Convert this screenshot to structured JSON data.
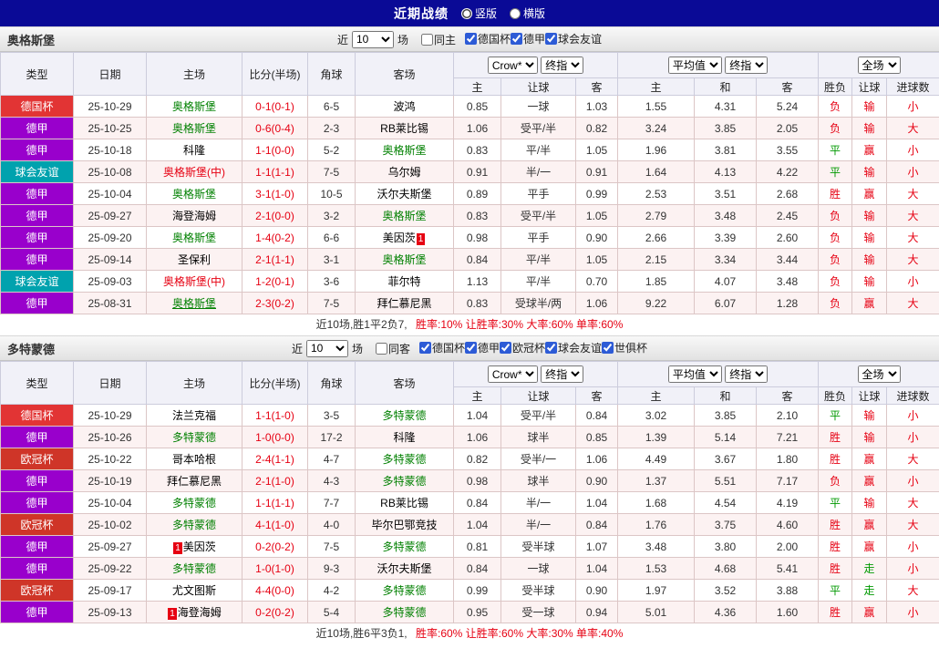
{
  "topbar": {
    "title": "近期战绩",
    "layout_options": [
      {
        "label": "竖版",
        "checked": true
      },
      {
        "label": "横版",
        "checked": false
      }
    ]
  },
  "labels": {
    "recent_prefix": "近",
    "recent_suffix": "场"
  },
  "table_header": {
    "cols": [
      "类型",
      "日期",
      "主场",
      "比分(半场)",
      "角球",
      "客场"
    ],
    "bookmaker": "Crow*",
    "final_label": "终指",
    "avg_label": "平均值",
    "scope_label": "全场",
    "sub": [
      "主",
      "让球",
      "客",
      "主",
      "和",
      "客",
      "胜负",
      "让球",
      "进球数"
    ]
  },
  "type_colors": {
    "德国杯": "#e23434",
    "德甲": "#9900cc",
    "球会友谊": "#00a2ae",
    "欧冠杯": "#cf3528",
    "世俱杯": "#888888"
  },
  "result_colors": {
    "r": "#e60012",
    "g": "#009900"
  },
  "sections": [
    {
      "team": "奥格斯堡",
      "filter": {
        "recent": "10",
        "same_label": "同主",
        "same_checked": false,
        "competitions": [
          {
            "label": "德国杯",
            "checked": true
          },
          {
            "label": "德甲",
            "checked": true
          },
          {
            "label": "球会友谊",
            "checked": true
          }
        ]
      },
      "rows": [
        {
          "tp": "德国杯",
          "dt": "25-10-29",
          "h": {
            "n": "奥格斯堡",
            "c": "g"
          },
          "sc": "0-1(0-1)",
          "cn": "6-5",
          "a": {
            "n": "波鸿"
          },
          "o1": [
            "0.85",
            "一球",
            "1.03"
          ],
          "o2": [
            "1.55",
            "4.31",
            "5.24"
          ],
          "rs": [
            [
              "负",
              "r"
            ],
            [
              "输",
              "r"
            ],
            [
              "小",
              "r"
            ]
          ]
        },
        {
          "tp": "德甲",
          "dt": "25-10-25",
          "h": {
            "n": "奥格斯堡",
            "c": "g"
          },
          "sc": "0-6(0-4)",
          "cn": "2-3",
          "a": {
            "n": "RB莱比锡"
          },
          "o1": [
            "1.06",
            "受平/半",
            "0.82"
          ],
          "o2": [
            "3.24",
            "3.85",
            "2.05"
          ],
          "rs": [
            [
              "负",
              "r"
            ],
            [
              "输",
              "r"
            ],
            [
              "大",
              "r"
            ]
          ]
        },
        {
          "tp": "德甲",
          "dt": "25-10-18",
          "h": {
            "n": "科隆"
          },
          "sc": "1-1(0-0)",
          "cn": "5-2",
          "a": {
            "n": "奥格斯堡",
            "c": "g"
          },
          "o1": [
            "0.83",
            "平/半",
            "1.05"
          ],
          "o2": [
            "1.96",
            "3.81",
            "3.55"
          ],
          "rs": [
            [
              "平",
              "g"
            ],
            [
              "赢",
              "r"
            ],
            [
              "小",
              "r"
            ]
          ]
        },
        {
          "tp": "球会友谊",
          "dt": "25-10-08",
          "h": {
            "n": "奥格斯堡(中)",
            "c": "r"
          },
          "sc": "1-1(1-1)",
          "cn": "7-5",
          "a": {
            "n": "乌尔姆"
          },
          "o1": [
            "0.91",
            "半/一",
            "0.91"
          ],
          "o2": [
            "1.64",
            "4.13",
            "4.22"
          ],
          "rs": [
            [
              "平",
              "g"
            ],
            [
              "输",
              "r"
            ],
            [
              "小",
              "r"
            ]
          ]
        },
        {
          "tp": "德甲",
          "dt": "25-10-04",
          "h": {
            "n": "奥格斯堡",
            "c": "g"
          },
          "sc": "3-1(1-0)",
          "cn": "10-5",
          "a": {
            "n": "沃尔夫斯堡"
          },
          "o1": [
            "0.89",
            "平手",
            "0.99"
          ],
          "o2": [
            "2.53",
            "3.51",
            "2.68"
          ],
          "rs": [
            [
              "胜",
              "r"
            ],
            [
              "赢",
              "r"
            ],
            [
              "大",
              "r"
            ]
          ]
        },
        {
          "tp": "德甲",
          "dt": "25-09-27",
          "h": {
            "n": "海登海姆"
          },
          "sc": "2-1(0-0)",
          "cn": "3-2",
          "a": {
            "n": "奥格斯堡",
            "c": "g"
          },
          "o1": [
            "0.83",
            "受平/半",
            "1.05"
          ],
          "o2": [
            "2.79",
            "3.48",
            "2.45"
          ],
          "rs": [
            [
              "负",
              "r"
            ],
            [
              "输",
              "r"
            ],
            [
              "大",
              "r"
            ]
          ]
        },
        {
          "tp": "德甲",
          "dt": "25-09-20",
          "h": {
            "n": "奥格斯堡",
            "c": "g"
          },
          "sc": "1-4(0-2)",
          "cn": "6-6",
          "a": {
            "n": "美因茨",
            "b": "1",
            "bp": "r"
          },
          "o1": [
            "0.98",
            "平手",
            "0.90"
          ],
          "o2": [
            "2.66",
            "3.39",
            "2.60"
          ],
          "rs": [
            [
              "负",
              "r"
            ],
            [
              "输",
              "r"
            ],
            [
              "大",
              "r"
            ]
          ]
        },
        {
          "tp": "德甲",
          "dt": "25-09-14",
          "h": {
            "n": "圣保利"
          },
          "sc": "2-1(1-1)",
          "cn": "3-1",
          "a": {
            "n": "奥格斯堡",
            "c": "g"
          },
          "o1": [
            "0.84",
            "平/半",
            "1.05"
          ],
          "o2": [
            "2.15",
            "3.34",
            "3.44"
          ],
          "rs": [
            [
              "负",
              "r"
            ],
            [
              "输",
              "r"
            ],
            [
              "大",
              "r"
            ]
          ]
        },
        {
          "tp": "球会友谊",
          "dt": "25-09-03",
          "h": {
            "n": "奥格斯堡(中)",
            "c": "r"
          },
          "sc": "1-2(0-1)",
          "cn": "3-6",
          "a": {
            "n": "菲尔特"
          },
          "o1": [
            "1.13",
            "平/半",
            "0.70"
          ],
          "o2": [
            "1.85",
            "4.07",
            "3.48"
          ],
          "rs": [
            [
              "负",
              "r"
            ],
            [
              "输",
              "r"
            ],
            [
              "小",
              "r"
            ]
          ]
        },
        {
          "tp": "德甲",
          "dt": "25-08-31",
          "h": {
            "n": "奥格斯堡",
            "c": "g",
            "u": true
          },
          "sc": "2-3(0-2)",
          "cn": "7-5",
          "a": {
            "n": "拜仁慕尼黑"
          },
          "o1": [
            "0.83",
            "受球半/两",
            "1.06"
          ],
          "o2": [
            "9.22",
            "6.07",
            "1.28"
          ],
          "rs": [
            [
              "负",
              "r"
            ],
            [
              "赢",
              "r"
            ],
            [
              "大",
              "r"
            ]
          ]
        }
      ],
      "summary": {
        "prefix": "近10场,胜1平2负7,",
        "stats": "胜率:10% 让胜率:30% 大率:60% 单率:60%"
      }
    },
    {
      "team": "多特蒙德",
      "filter": {
        "recent": "10",
        "same_label": "同客",
        "same_checked": false,
        "competitions": [
          {
            "label": "德国杯",
            "checked": true
          },
          {
            "label": "德甲",
            "checked": true
          },
          {
            "label": "欧冠杯",
            "checked": true
          },
          {
            "label": "球会友谊",
            "checked": true
          },
          {
            "label": "世俱杯",
            "checked": true
          }
        ]
      },
      "rows": [
        {
          "tp": "德国杯",
          "dt": "25-10-29",
          "h": {
            "n": "法兰克福"
          },
          "sc": "1-1(1-0)",
          "cn": "3-5",
          "a": {
            "n": "多特蒙德",
            "c": "g"
          },
          "o1": [
            "1.04",
            "受平/半",
            "0.84"
          ],
          "o2": [
            "3.02",
            "3.85",
            "2.10"
          ],
          "rs": [
            [
              "平",
              "g"
            ],
            [
              "输",
              "r"
            ],
            [
              "小",
              "r"
            ]
          ]
        },
        {
          "tp": "德甲",
          "dt": "25-10-26",
          "h": {
            "n": "多特蒙德",
            "c": "g"
          },
          "sc": "1-0(0-0)",
          "cn": "17-2",
          "a": {
            "n": "科隆"
          },
          "o1": [
            "1.06",
            "球半",
            "0.85"
          ],
          "o2": [
            "1.39",
            "5.14",
            "7.21"
          ],
          "rs": [
            [
              "胜",
              "r"
            ],
            [
              "输",
              "r"
            ],
            [
              "小",
              "r"
            ]
          ]
        },
        {
          "tp": "欧冠杯",
          "dt": "25-10-22",
          "h": {
            "n": "哥本哈根"
          },
          "sc": "2-4(1-1)",
          "cn": "4-7",
          "a": {
            "n": "多特蒙德",
            "c": "g"
          },
          "o1": [
            "0.82",
            "受半/一",
            "1.06"
          ],
          "o2": [
            "4.49",
            "3.67",
            "1.80"
          ],
          "rs": [
            [
              "胜",
              "r"
            ],
            [
              "赢",
              "r"
            ],
            [
              "大",
              "r"
            ]
          ]
        },
        {
          "tp": "德甲",
          "dt": "25-10-19",
          "h": {
            "n": "拜仁慕尼黑"
          },
          "sc": "2-1(1-0)",
          "cn": "4-3",
          "a": {
            "n": "多特蒙德",
            "c": "g"
          },
          "o1": [
            "0.98",
            "球半",
            "0.90"
          ],
          "o2": [
            "1.37",
            "5.51",
            "7.17"
          ],
          "rs": [
            [
              "负",
              "r"
            ],
            [
              "赢",
              "r"
            ],
            [
              "小",
              "r"
            ]
          ]
        },
        {
          "tp": "德甲",
          "dt": "25-10-04",
          "h": {
            "n": "多特蒙德",
            "c": "g"
          },
          "sc": "1-1(1-1)",
          "cn": "7-7",
          "a": {
            "n": "RB莱比锡"
          },
          "o1": [
            "0.84",
            "半/一",
            "1.04"
          ],
          "o2": [
            "1.68",
            "4.54",
            "4.19"
          ],
          "rs": [
            [
              "平",
              "g"
            ],
            [
              "输",
              "r"
            ],
            [
              "大",
              "r"
            ]
          ]
        },
        {
          "tp": "欧冠杯",
          "dt": "25-10-02",
          "h": {
            "n": "多特蒙德",
            "c": "g"
          },
          "sc": "4-1(1-0)",
          "cn": "4-0",
          "a": {
            "n": "毕尔巴鄂竞技"
          },
          "o1": [
            "1.04",
            "半/一",
            "0.84"
          ],
          "o2": [
            "1.76",
            "3.75",
            "4.60"
          ],
          "rs": [
            [
              "胜",
              "r"
            ],
            [
              "赢",
              "r"
            ],
            [
              "大",
              "r"
            ]
          ]
        },
        {
          "tp": "德甲",
          "dt": "25-09-27",
          "h": {
            "n": "美因茨",
            "b": "1",
            "bp": "l"
          },
          "sc": "0-2(0-2)",
          "cn": "7-5",
          "a": {
            "n": "多特蒙德",
            "c": "g"
          },
          "o1": [
            "0.81",
            "受半球",
            "1.07"
          ],
          "o2": [
            "3.48",
            "3.80",
            "2.00"
          ],
          "rs": [
            [
              "胜",
              "r"
            ],
            [
              "赢",
              "r"
            ],
            [
              "小",
              "r"
            ]
          ]
        },
        {
          "tp": "德甲",
          "dt": "25-09-22",
          "h": {
            "n": "多特蒙德",
            "c": "g"
          },
          "sc": "1-0(1-0)",
          "cn": "9-3",
          "a": {
            "n": "沃尔夫斯堡"
          },
          "o1": [
            "0.84",
            "一球",
            "1.04"
          ],
          "o2": [
            "1.53",
            "4.68",
            "5.41"
          ],
          "rs": [
            [
              "胜",
              "r"
            ],
            [
              "走",
              "g"
            ],
            [
              "小",
              "r"
            ]
          ]
        },
        {
          "tp": "欧冠杯",
          "dt": "25-09-17",
          "h": {
            "n": "尤文图斯"
          },
          "sc": "4-4(0-0)",
          "cn": "4-2",
          "a": {
            "n": "多特蒙德",
            "c": "g"
          },
          "o1": [
            "0.99",
            "受半球",
            "0.90"
          ],
          "o2": [
            "1.97",
            "3.52",
            "3.88"
          ],
          "rs": [
            [
              "平",
              "g"
            ],
            [
              "走",
              "g"
            ],
            [
              "大",
              "r"
            ]
          ]
        },
        {
          "tp": "德甲",
          "dt": "25-09-13",
          "h": {
            "n": "海登海姆",
            "b": "1",
            "bp": "l"
          },
          "sc": "0-2(0-2)",
          "cn": "5-4",
          "a": {
            "n": "多特蒙德",
            "c": "g"
          },
          "o1": [
            "0.95",
            "受一球",
            "0.94"
          ],
          "o2": [
            "5.01",
            "4.36",
            "1.60"
          ],
          "rs": [
            [
              "胜",
              "r"
            ],
            [
              "赢",
              "r"
            ],
            [
              "小",
              "r"
            ]
          ]
        }
      ],
      "summary": {
        "prefix": "近10场,胜6平3负1,",
        "stats": "胜率:60% 让胜率:60% 大率:30% 单率:40%"
      }
    }
  ]
}
